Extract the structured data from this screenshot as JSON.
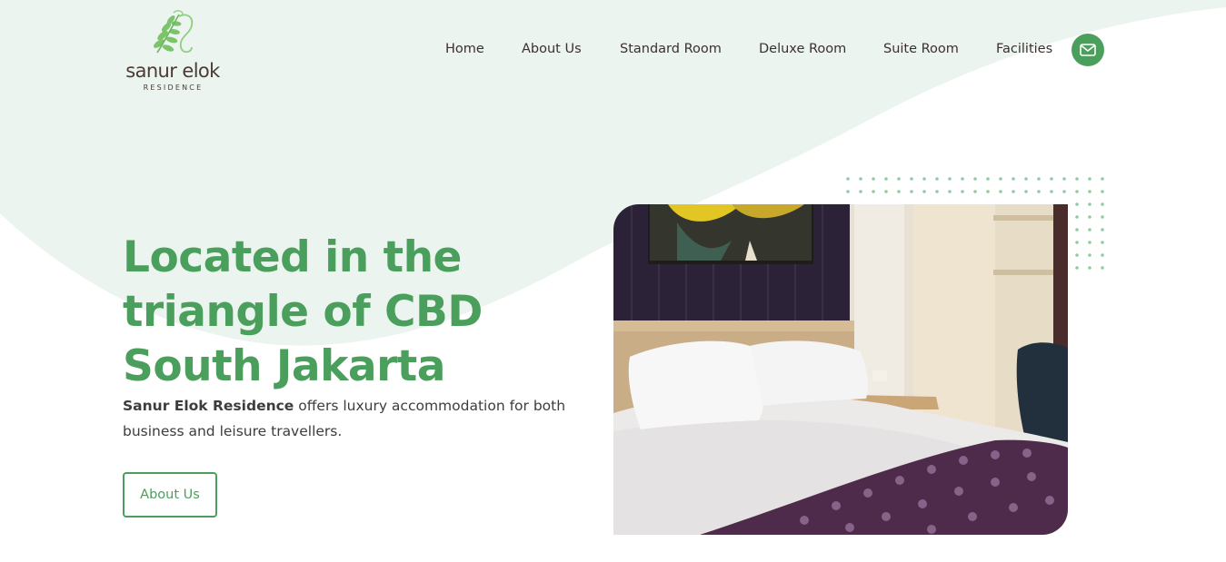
{
  "brand": {
    "name": "sanur elok",
    "sub": "RESIDENCE"
  },
  "nav": {
    "items": [
      {
        "label": "Home"
      },
      {
        "label": "About Us"
      },
      {
        "label": "Standard Room"
      },
      {
        "label": "Deluxe Room"
      },
      {
        "label": "Suite Room"
      },
      {
        "label": "Facilities"
      }
    ],
    "contact_icon": "mail-icon"
  },
  "hero": {
    "title": "Located in the triangle of CBD South Jakarta",
    "description_strong": "Sanur Elok Residence",
    "description_rest": " offers luxury accommodation for both business and leisure travellers.",
    "button_label": "About Us",
    "image_icon": "hotel-bedroom-photo"
  },
  "colors": {
    "accent": "#4b9f5c",
    "wave_background": "#ebf4ee",
    "text_dark": "#3b3030",
    "dots": "#8fcca4"
  }
}
